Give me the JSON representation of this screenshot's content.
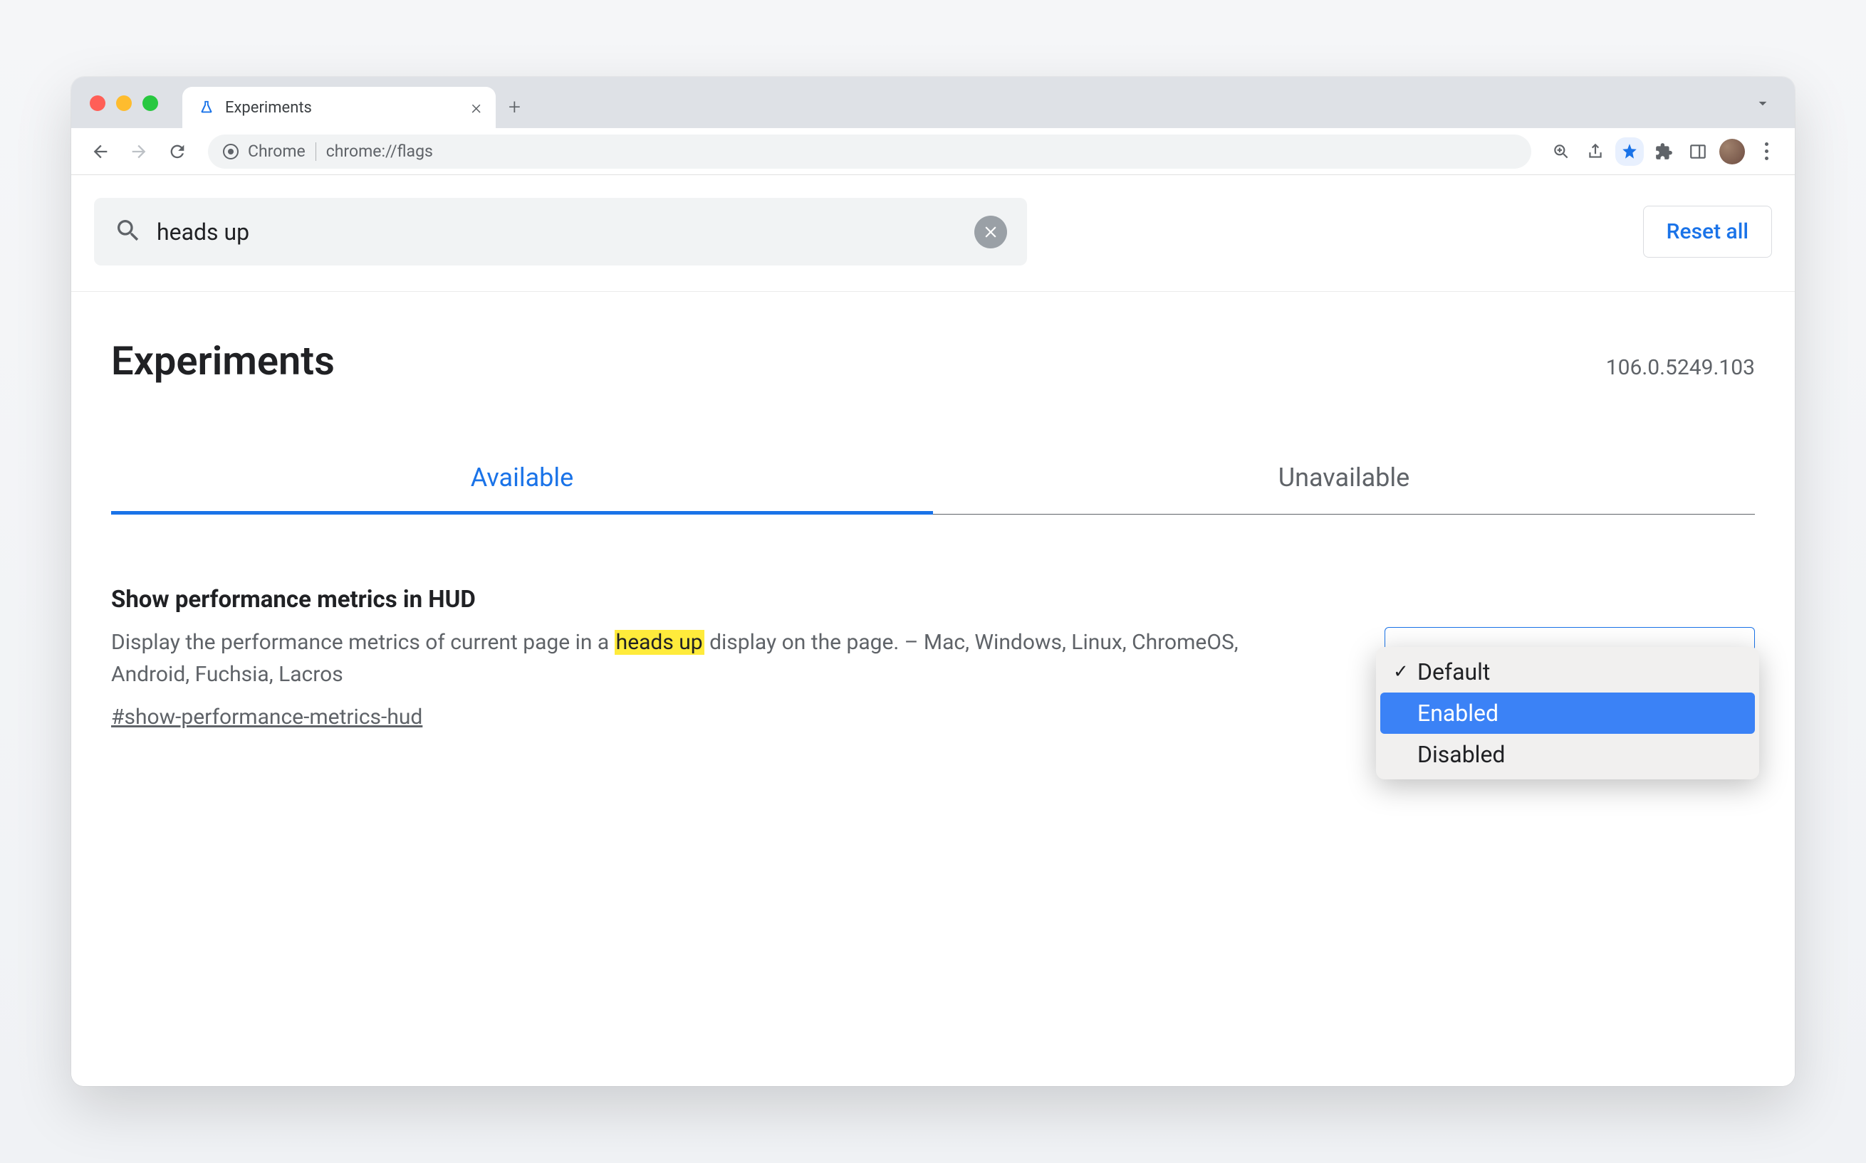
{
  "tab": {
    "title": "Experiments"
  },
  "omnibox": {
    "label": "Chrome",
    "url": "chrome://flags"
  },
  "search": {
    "value": "heads up"
  },
  "reset_label": "Reset all",
  "page_title": "Experiments",
  "version": "106.0.5249.103",
  "tabs": {
    "available": "Available",
    "unavailable": "Unavailable"
  },
  "flag": {
    "title": "Show performance metrics in HUD",
    "desc_prefix": "Display the performance metrics of current page in a ",
    "desc_highlight": "heads up",
    "desc_suffix": " display on the page. – Mac, Windows, Linux, ChromeOS, Android, Fuchsia, Lacros",
    "anchor": "#show-performance-metrics-hud"
  },
  "dropdown": {
    "options": [
      "Default",
      "Enabled",
      "Disabled"
    ],
    "selected": "Enabled",
    "checked": "Default"
  }
}
